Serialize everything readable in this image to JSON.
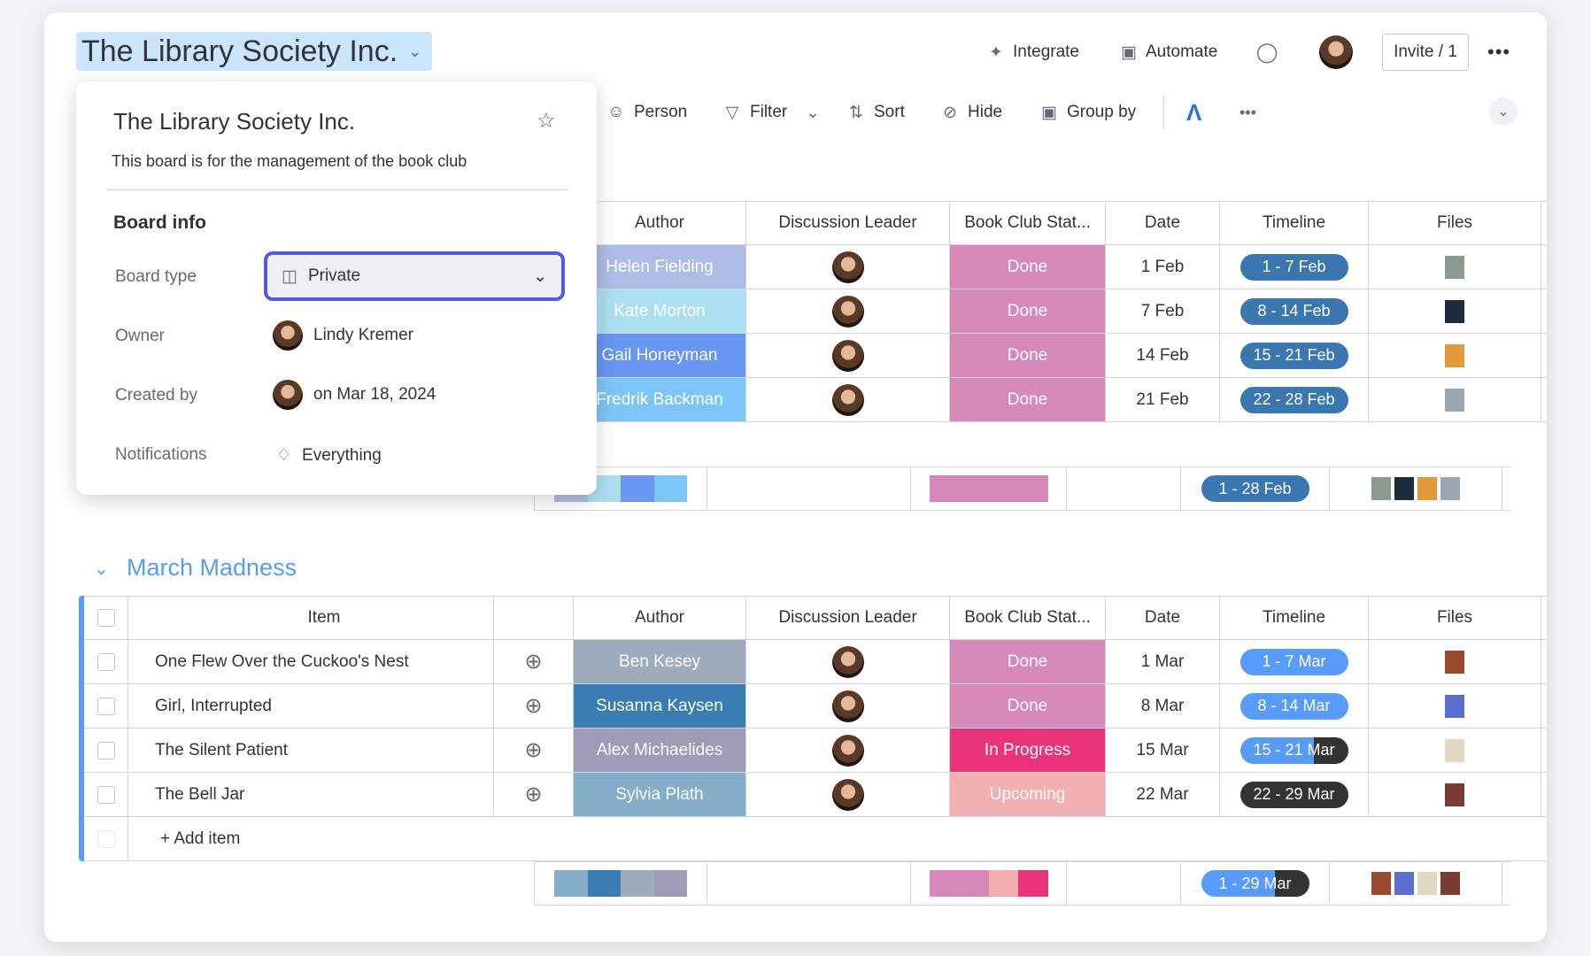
{
  "board": {
    "title": "The Library Society Inc."
  },
  "header": {
    "integrate": "Integrate",
    "automate": "Automate",
    "invite": "Invite / 1"
  },
  "toolbar": {
    "person": "Person",
    "filter": "Filter",
    "sort": "Sort",
    "hide": "Hide",
    "group_by": "Group by"
  },
  "popup": {
    "title": "The Library Society Inc.",
    "description": "This board is for the management of the book club",
    "section": "Board info",
    "board_type_label": "Board type",
    "board_type_value": "Private",
    "owner_label": "Owner",
    "owner_value": "Lindy Kremer",
    "created_label": "Created by",
    "created_value": "on Mar 18, 2024",
    "notifications_label": "Notifications",
    "notifications_value": "Everything"
  },
  "columns": [
    "Item",
    "Author",
    "Discussion Leader",
    "Book Club Stat...",
    "Date",
    "Timeline",
    "Files"
  ],
  "colors": {
    "done": "#d689b8",
    "in_progress": "#ea3379",
    "upcoming": "#f3b0b0",
    "timeline_dark": "#3a77b0",
    "timeline_blue": "#579bfc",
    "timeline_black": "#333333",
    "group_accent": "#579bfc"
  },
  "group1": {
    "rows": [
      {
        "author": "Helen Fielding",
        "author_color": "#aebde6",
        "status": "Done",
        "date": "1 Feb",
        "timeline": "1 - 7 Feb",
        "progress": 1,
        "tl_color": "#3a77b0",
        "thumb": "#8a9a8e",
        "badge": true
      },
      {
        "author": "Kate Morton",
        "author_color": "#addff3",
        "status": "Done",
        "date": "7 Feb",
        "timeline": "8 - 14 Feb",
        "progress": 1,
        "tl_color": "#3a77b0",
        "thumb": "#1d2b3e",
        "badge": false
      },
      {
        "author": "Gail Honeyman",
        "author_color": "#6896f2",
        "status": "Done",
        "date": "14 Feb",
        "timeline": "15 - 21 Feb",
        "progress": 1,
        "tl_color": "#3a77b0",
        "thumb": "#e09a3a",
        "badge": false
      },
      {
        "author": "Fredrik Backman",
        "author_color": "#7cc6f7",
        "status": "Done",
        "date": "21 Feb",
        "timeline": "22 - 28 Feb",
        "progress": 1,
        "tl_color": "#3a77b0",
        "thumb": "#9aa6b0",
        "badge": true
      }
    ],
    "summary": {
      "timeline": "1 - 28 Feb",
      "author_colors": [
        "#aebde6",
        "#addff3",
        "#6896f2",
        "#7cc6f7"
      ],
      "status": [
        {
          "color": "#d689b8",
          "share": 1
        }
      ]
    }
  },
  "group2": {
    "title": "March Madness",
    "add_item": "+ Add item",
    "rows": [
      {
        "item": "One Flew Over the Cuckoo's Nest",
        "author": "Ben Kesey",
        "author_color": "#9eabbb",
        "status": "Done",
        "status_color": "#d689b8",
        "date": "1 Mar",
        "timeline": "1 - 7 Mar",
        "progress": 1,
        "tl_color": "#579bfc",
        "thumb": "#9a4a2e"
      },
      {
        "item": "Girl, Interrupted",
        "author": "Susanna Kaysen",
        "author_color": "#3a7db2",
        "status": "Done",
        "status_color": "#d689b8",
        "date": "8 Mar",
        "timeline": "8 - 14 Mar",
        "progress": 1,
        "tl_color": "#579bfc",
        "thumb": "#5b6fd0"
      },
      {
        "item": "The Silent Patient",
        "author": "Alex Michaelides",
        "author_color": "#9d9bb6",
        "status": "In Progress",
        "status_color": "#ea3379",
        "date": "15 Mar",
        "timeline": "15 - 21 Mar",
        "progress": 0.68,
        "tl_color": "#579bfc",
        "thumb": "#e2d8c0"
      },
      {
        "item": "The Bell Jar",
        "author": "Sylvia Plath",
        "author_color": "#83adc9",
        "status": "Upcoming",
        "status_color": "#f3b0b0",
        "date": "22 Mar",
        "timeline": "22 - 29 Mar",
        "progress": 0,
        "tl_color": "#333333",
        "thumb": "#7a3b32"
      }
    ],
    "summary": {
      "timeline": "1 - 29 Mar",
      "progress": 0.68,
      "author_colors": [
        "#83adc9",
        "#3a7db2",
        "#9eabbb",
        "#9d9bb6"
      ],
      "status": [
        {
          "color": "#d689b8",
          "share": 0.5
        },
        {
          "color": "#f3b0b0",
          "share": 0.25
        },
        {
          "color": "#ea3379",
          "share": 0.25
        }
      ]
    }
  }
}
